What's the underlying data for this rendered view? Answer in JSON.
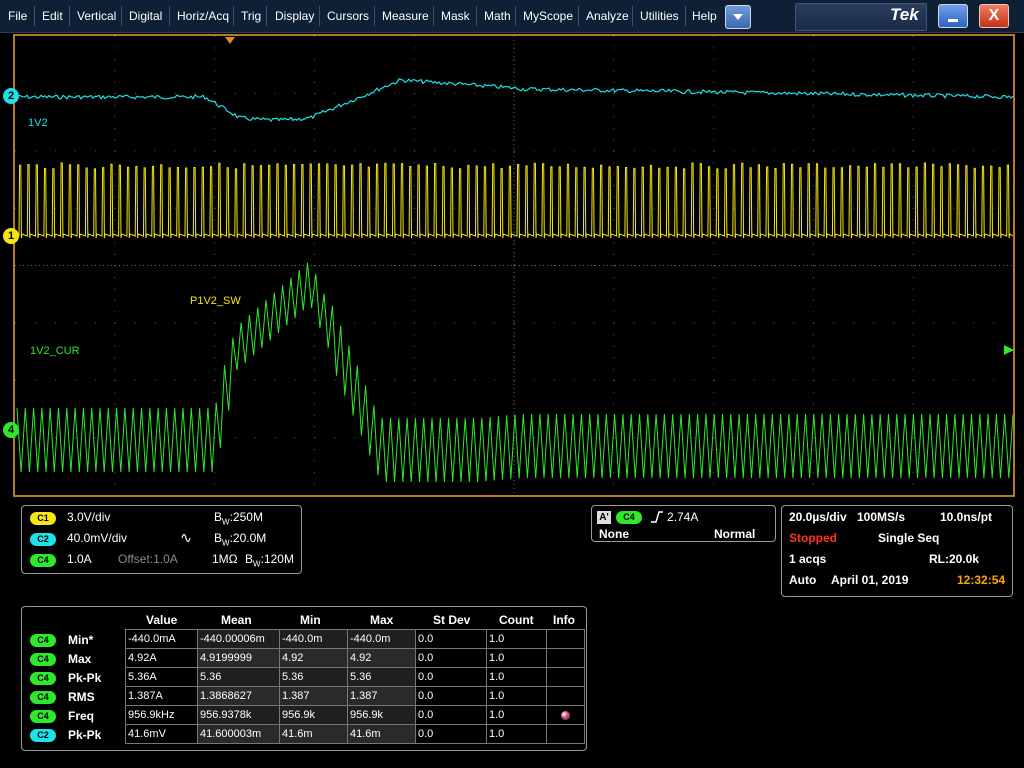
{
  "menu": {
    "items": [
      {
        "label": "File"
      },
      {
        "label": "Edit"
      },
      {
        "label": "Vertical"
      },
      {
        "label": "Digital"
      },
      {
        "label": "Horiz/Acq"
      },
      {
        "label": "Trig"
      },
      {
        "label": "Display"
      },
      {
        "label": "Cursors"
      },
      {
        "label": "Measure"
      },
      {
        "label": "Mask"
      },
      {
        "label": "Math"
      },
      {
        "label": "MyScope"
      },
      {
        "label": "Analyze"
      },
      {
        "label": "Utilities"
      },
      {
        "label": "Help"
      }
    ],
    "brand": "Tek",
    "close_glyph": "X"
  },
  "colors": {
    "ch1": "#f5e612",
    "ch2": "#1ee0e8",
    "ch4": "#2ee82a",
    "frame": "#b77a2c",
    "stopped": "#ff3020",
    "clock": "#ffa500"
  },
  "waveforms": {
    "ch2_label": "1V2",
    "ch1_label": "P1V2_SW",
    "ch4_label": "1V2_CUR",
    "markers": {
      "ch2": "2",
      "ch1": "1",
      "ch4": "4"
    }
  },
  "channel_panel": {
    "rows": [
      {
        "badge": "C1",
        "scale": "3.0V/div",
        "bw": "250M"
      },
      {
        "badge": "C2",
        "scale": "40.0mV/div",
        "bw": "20.0M"
      },
      {
        "badge": "C4",
        "scale": "1.0A",
        "offset": "Offset:1.0A",
        "impedance": "1MΩ",
        "bw": "120M"
      }
    ],
    "bw_prefix": "B",
    "bw_sub": "W",
    "bw_sep": ":"
  },
  "trigger_panel": {
    "a_label": "A'",
    "source": "C4",
    "level": "2.74A",
    "type": "None",
    "mode": "Normal"
  },
  "acq_panel": {
    "horiz_scale": "20.0µs/div",
    "sample_rate": "100MS/s",
    "resolution": "10.0ns/pt",
    "status": "Stopped",
    "seq_mode": "Single Seq",
    "acqs": "1 acqs",
    "record_length": "RL:20.0k",
    "trigger_mode": "Auto",
    "date": "April 01, 2019",
    "time": "12:32:54"
  },
  "measurements": {
    "headers": [
      "Value",
      "Mean",
      "Min",
      "Max",
      "St Dev",
      "Count",
      "Info"
    ],
    "rows": [
      {
        "badge": "C4",
        "name": "Min*",
        "value": "-440.0mA",
        "mean": "-440.00006m",
        "min": "-440.0m",
        "max": "-440.0m",
        "stdev": "0.0",
        "count": "1.0"
      },
      {
        "badge": "C4",
        "name": "Max",
        "value": "4.92A",
        "mean": "4.9199999",
        "min": "4.92",
        "max": "4.92",
        "stdev": "0.0",
        "count": "1.0"
      },
      {
        "badge": "C4",
        "name": "Pk-Pk",
        "value": "5.36A",
        "mean": "5.36",
        "min": "5.36",
        "max": "5.36",
        "stdev": "0.0",
        "count": "1.0"
      },
      {
        "badge": "C4",
        "name": "RMS",
        "value": "1.387A",
        "mean": "1.3868627",
        "min": "1.387",
        "max": "1.387",
        "stdev": "0.0",
        "count": "1.0"
      },
      {
        "badge": "C4",
        "name": "Freq",
        "value": "956.9kHz",
        "mean": "956.9378k",
        "min": "956.9k",
        "max": "956.9k",
        "stdev": "0.0",
        "count": "1.0",
        "info": "info-dot-icon"
      },
      {
        "badge": "C2",
        "name": "Pk-Pk",
        "value": "41.6mV",
        "mean": "41.600003m",
        "min": "41.6m",
        "max": "41.6m",
        "stdev": "0.0",
        "count": "1.0"
      }
    ]
  }
}
